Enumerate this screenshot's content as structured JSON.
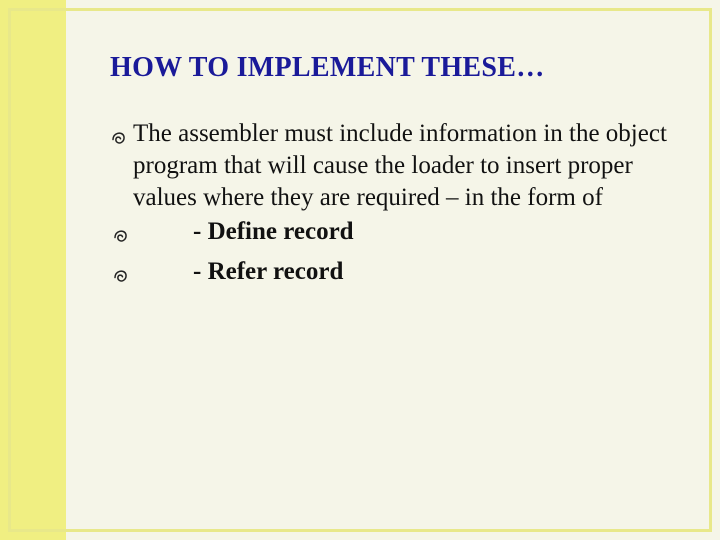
{
  "title": "HOW TO IMPLEMENT THESE…",
  "body": {
    "paragraph": "The assembler must include information in the object program that will cause the loader to insert proper values where they are required – in the form of",
    "sub1": "- Define record",
    "sub2": "- Refer record"
  }
}
